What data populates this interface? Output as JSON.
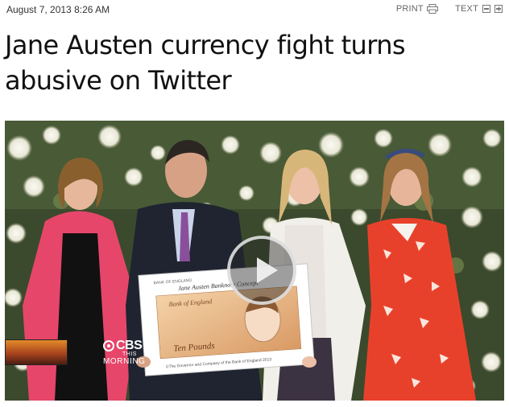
{
  "article": {
    "dateline": "August 7, 2013 8:26 AM",
    "headline_line1": "Jane Austen currency fight turns",
    "headline_line2": "abusive on Twitter"
  },
  "tools": {
    "print_label": "PRINT",
    "print_icon": "printer-icon",
    "text_label": "TEXT",
    "text_decrease_icon": "minus-box-icon",
    "text_increase_icon": "plus-box-icon"
  },
  "video": {
    "play_icon": "play-icon",
    "channel_brand": "CBS",
    "program_line1": "THIS",
    "program_line2": "MORNING",
    "note": {
      "bank": "BANK OF ENGLAND",
      "title": "Jane Austen Banknote Concept",
      "small_title": "Bank of England",
      "denomination": "Ten Pounds",
      "footer": "©The Governor and Company of the Bank of England 2013"
    }
  }
}
